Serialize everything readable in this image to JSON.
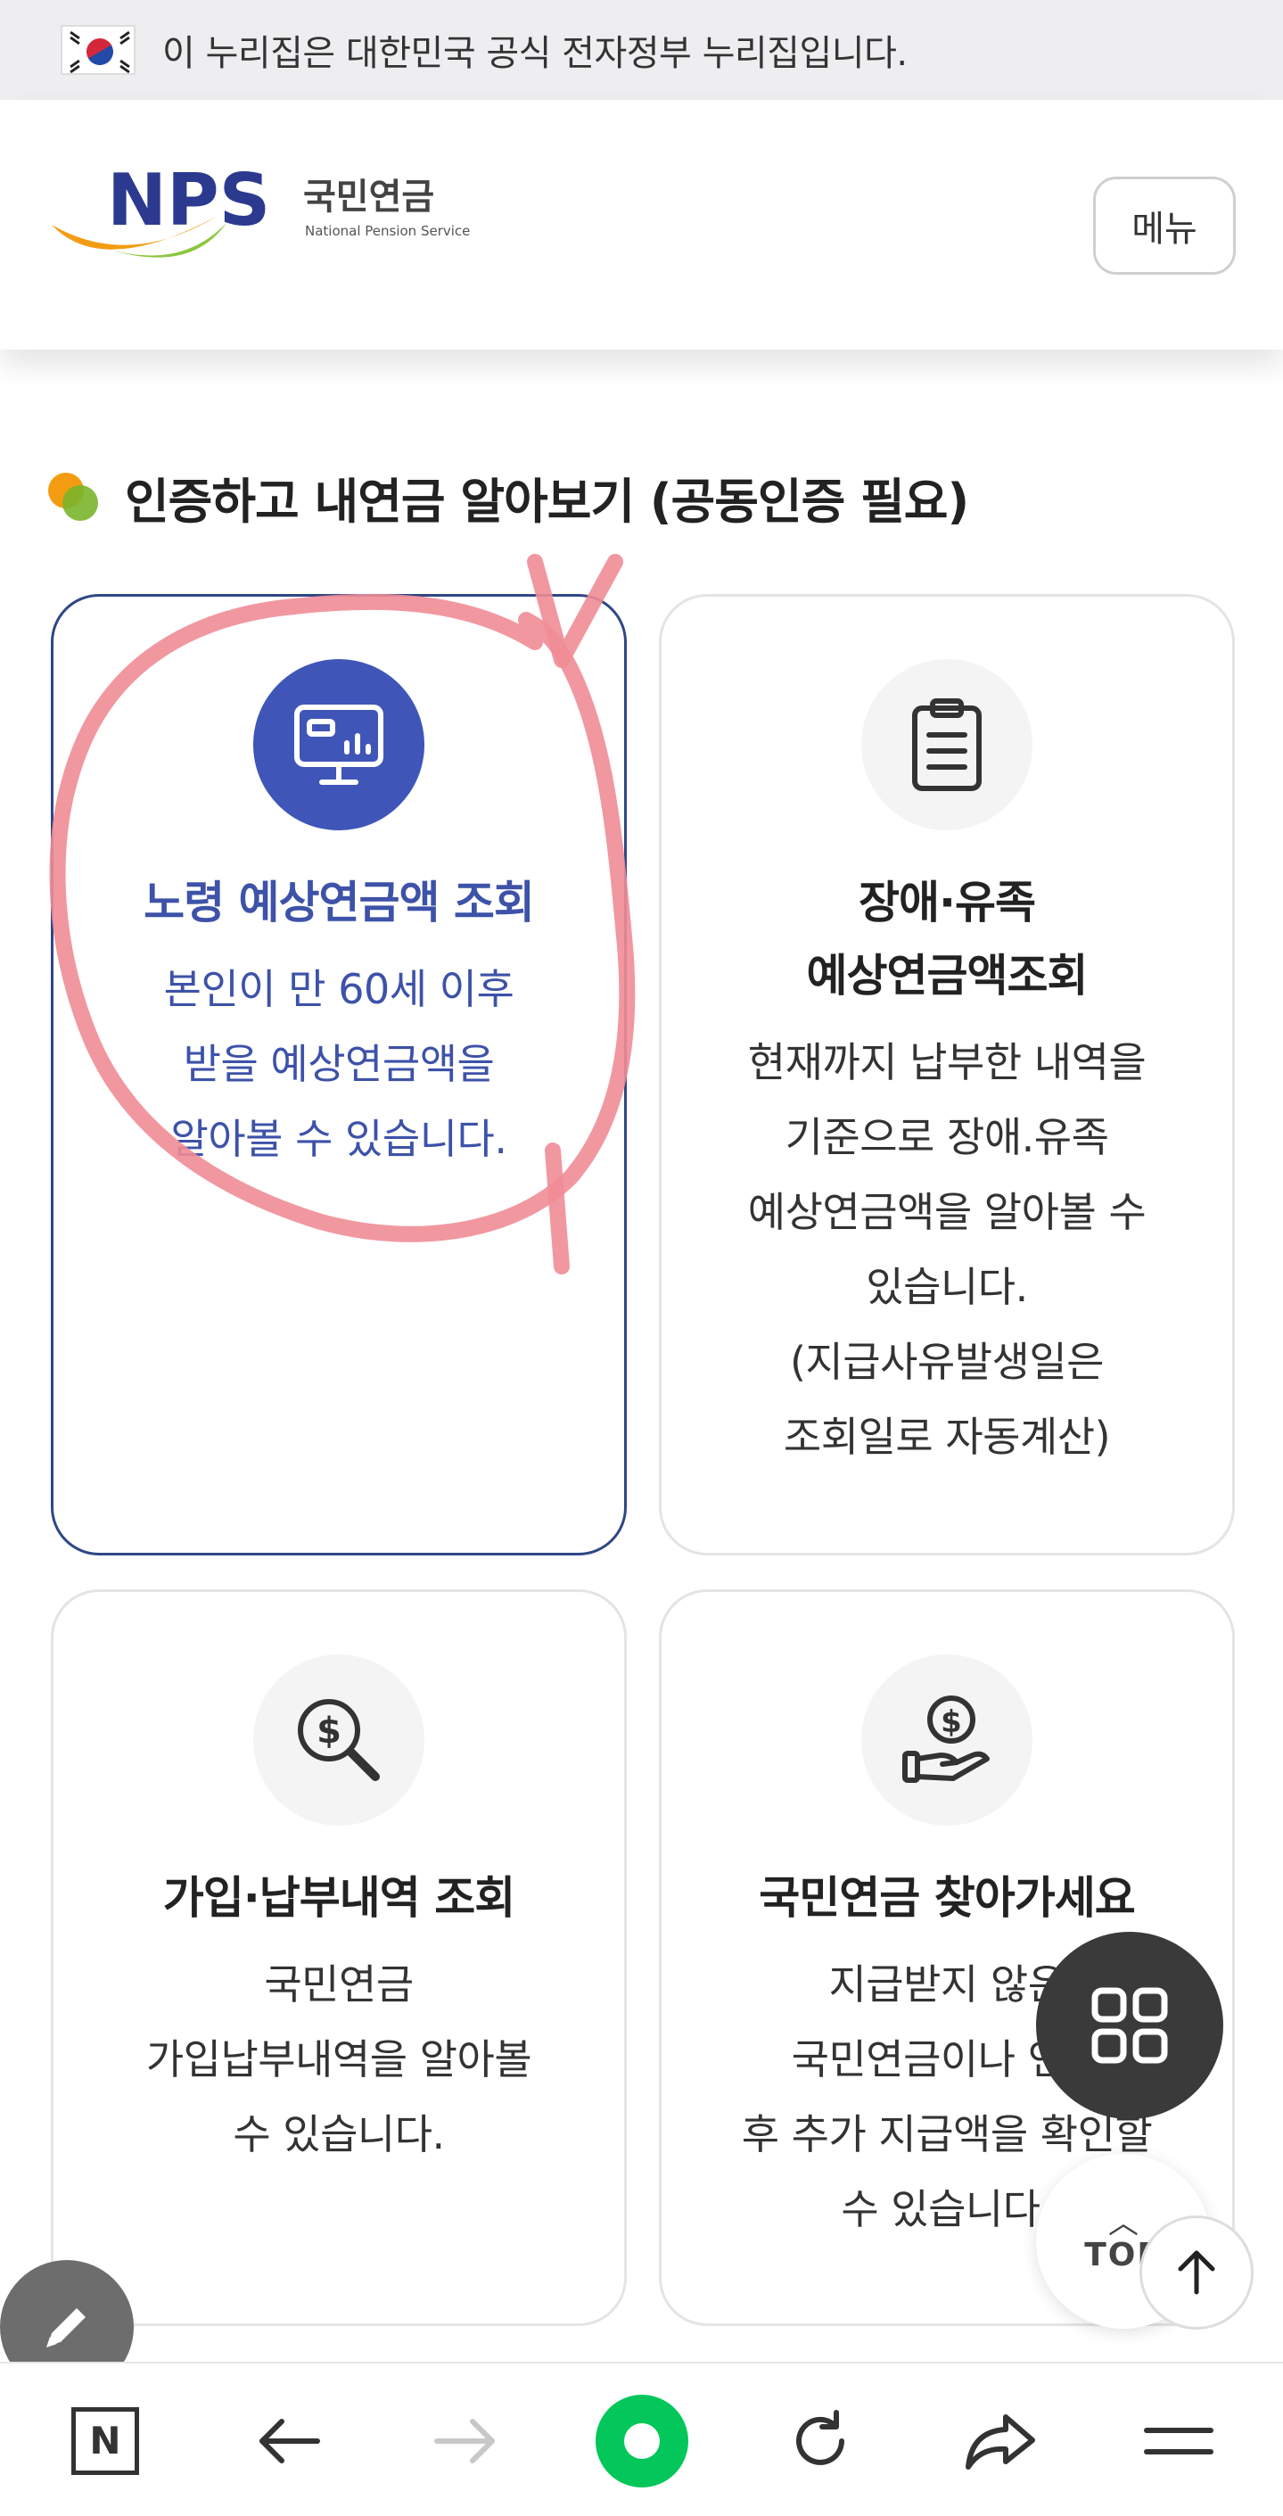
{
  "gov_banner": {
    "text": "이 누리집은 대한민국 공식 전자정부 누리집입니다."
  },
  "header": {
    "logo_letters": "NPS",
    "logo_korean": "국민연금",
    "logo_english": "National Pension Service",
    "menu_label": "메뉴"
  },
  "section": {
    "title": "인증하고 내연금 알아보기 (공동인증 필요)"
  },
  "cards": [
    {
      "icon": "monitor-chart-icon",
      "title": "노령 예상연금액 조회",
      "desc": [
        "본인이 만 60세 이후",
        "받을 예상연금액을",
        "알아볼 수 있습니다."
      ]
    },
    {
      "icon": "clipboard-icon",
      "title": [
        "장애·유족",
        "예상연금액조회"
      ],
      "desc": [
        "현재까지 납부한 내역을",
        "기준으로 장애.유족",
        "예상연금액을 알아볼 수",
        "있습니다.",
        "(지급사유발생일은",
        "조회일로 자동계산)"
      ]
    },
    {
      "icon": "dollar-search-icon",
      "title": "가입·납부내역 조회",
      "desc": [
        "국민연금",
        "가입납부내역을 알아볼",
        "수 있습니다."
      ]
    },
    {
      "icon": "hand-coin-icon",
      "title": "국민연금 찾아가세요",
      "desc": [
        "지급받지 않은",
        "국민연금이나 연금",
        "후 추가 지급액을 확인할",
        "수 있습니다."
      ]
    }
  ],
  "floating": {
    "top_label": "TOP"
  },
  "bottom_nav": {
    "items": [
      "naver-n-icon",
      "back-arrow-icon",
      "forward-arrow-icon",
      "naver-green-dot-icon",
      "refresh-icon",
      "share-icon",
      "hamburger-icon"
    ],
    "n_letter": "N"
  },
  "colors": {
    "accent_blue": "#3f56b8",
    "card_border_active": "#2f4785",
    "annotation_pink": "#f08c96",
    "naver_green": "#03c75a"
  }
}
